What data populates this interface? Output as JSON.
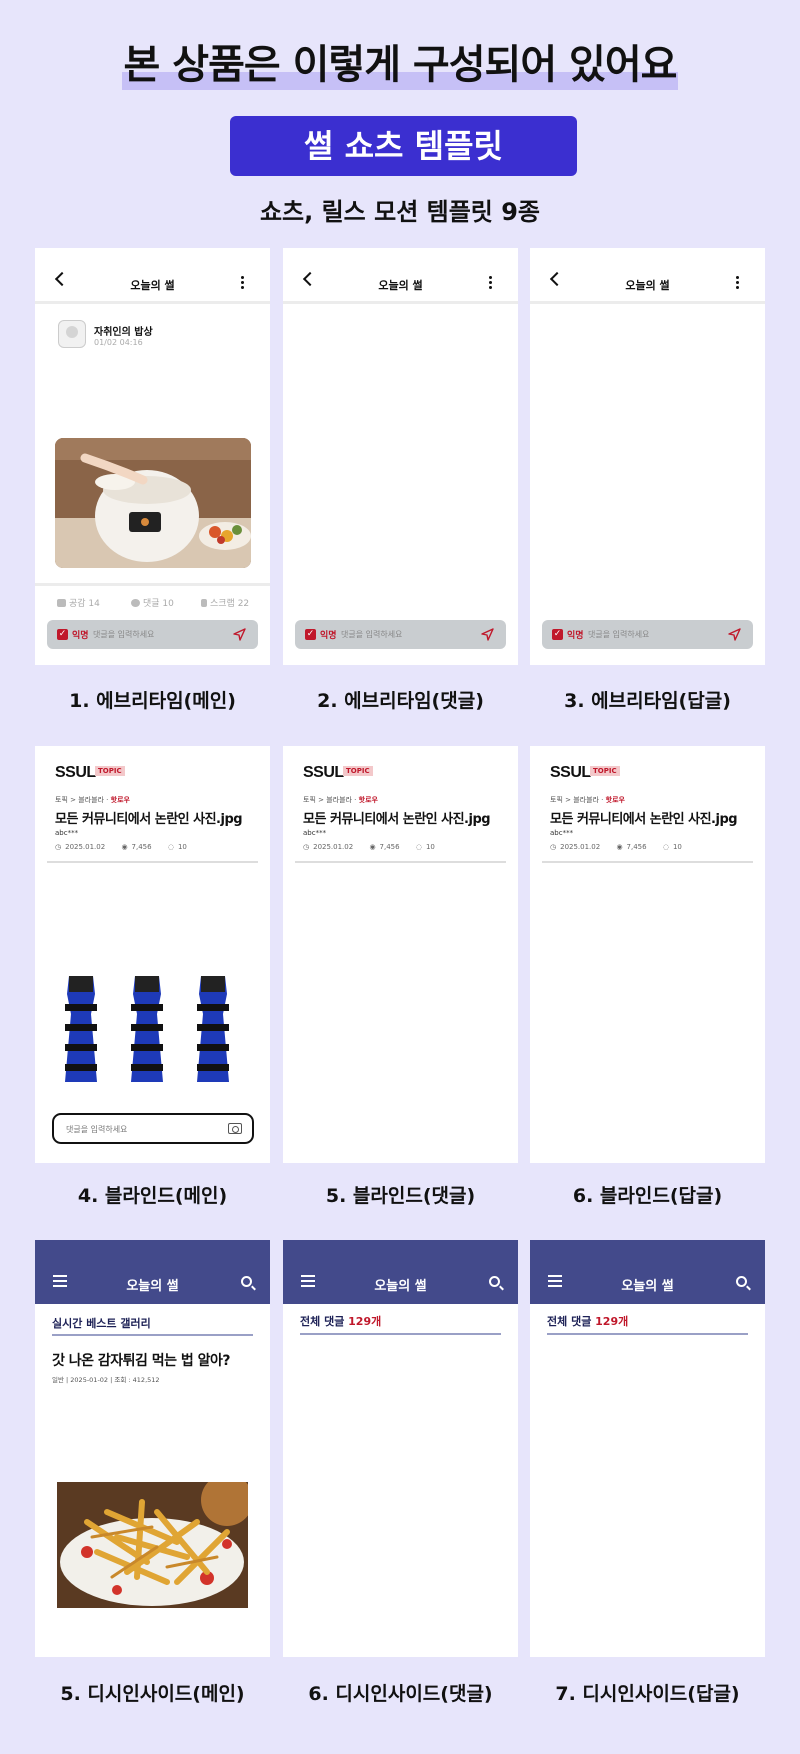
{
  "header": {
    "title": "본 상품은 이렇게 구성되어 있어요",
    "badge": "썰 쇼츠 템플릿",
    "subtitle": "쇼츠, 릴스 모션 템플릿 9종"
  },
  "everytime": {
    "nav_title": "오늘의 썰",
    "author_name": "자취인의 밥상",
    "post_date": "01/02  04:16",
    "like_label": "공감 14",
    "comment_label": "댓글 10",
    "scrap_label": "스크랩 22",
    "anonymous_label": "익명",
    "comment_placeholder": "댓글을 입력하세요",
    "captions": [
      "1. 에브리타임(메인)",
      "2. 에브리타임(댓글)",
      "3. 에브리타임(답글)"
    ]
  },
  "blind": {
    "logo": "SSUL",
    "logo_tag": "TOPIC",
    "breadcrumb_prefix": "토픽 > 블라블라 · ",
    "breadcrumb_hot": "핫로우",
    "post_title": "모든 커뮤니티에서 논란인 사진.jpg",
    "author": "abc***",
    "date": "2025.01.02",
    "views": "7,456",
    "comments": "10",
    "comment_placeholder": "댓글을 입력하세요",
    "captions": [
      "4. 블라인드(메인)",
      "5. 블라인드(댓글)",
      "6. 블라인드(답글)"
    ]
  },
  "dcinside": {
    "nav_title": "오늘의 썰",
    "gallery": "실시간 베스트 갤러리",
    "post_title": "갓 나온 감자튀김 먹는 법 알아?",
    "meta": "일반  |  2025-01-02  |  조회 : 412,512",
    "comment_label": "전체 댓글 ",
    "comment_count": "129개",
    "captions": [
      "5. 디시인사이드(메인)",
      "6. 디시인사이드(댓글)",
      "7. 디시인사이드(답글)"
    ]
  },
  "colors": {
    "background": "#e7e5fb",
    "badge": "#3b2fd0",
    "title_highlight": "#c6c0f6",
    "dc_header": "#434a8b",
    "accent_red": "#c0182b"
  }
}
